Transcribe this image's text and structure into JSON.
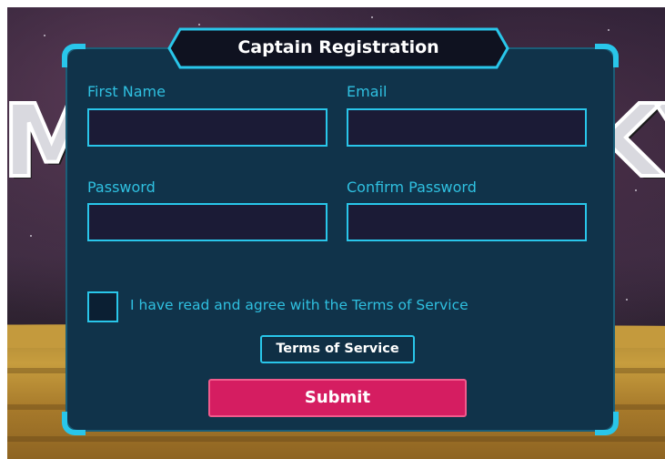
{
  "background": {
    "title_art_left": "M",
    "title_art_right": "KY"
  },
  "form": {
    "title": "Captain Registration",
    "fields": [
      {
        "label": "First Name",
        "value": "",
        "placeholder": ""
      },
      {
        "label": "Email",
        "value": "",
        "placeholder": ""
      },
      {
        "label": "Password",
        "value": "",
        "placeholder": ""
      },
      {
        "label": "Confirm Password",
        "value": "",
        "placeholder": ""
      }
    ],
    "agree_text": "I have read and agree with the Terms of Service",
    "agree_checked": false,
    "tos_label": "Terms of Service",
    "submit_label": "Submit"
  },
  "colors": {
    "accent": "#29c6ea",
    "label": "#2fc0e0",
    "panel": "#10334a",
    "input_bg": "#1b1b36",
    "submit": "#d51d61"
  }
}
